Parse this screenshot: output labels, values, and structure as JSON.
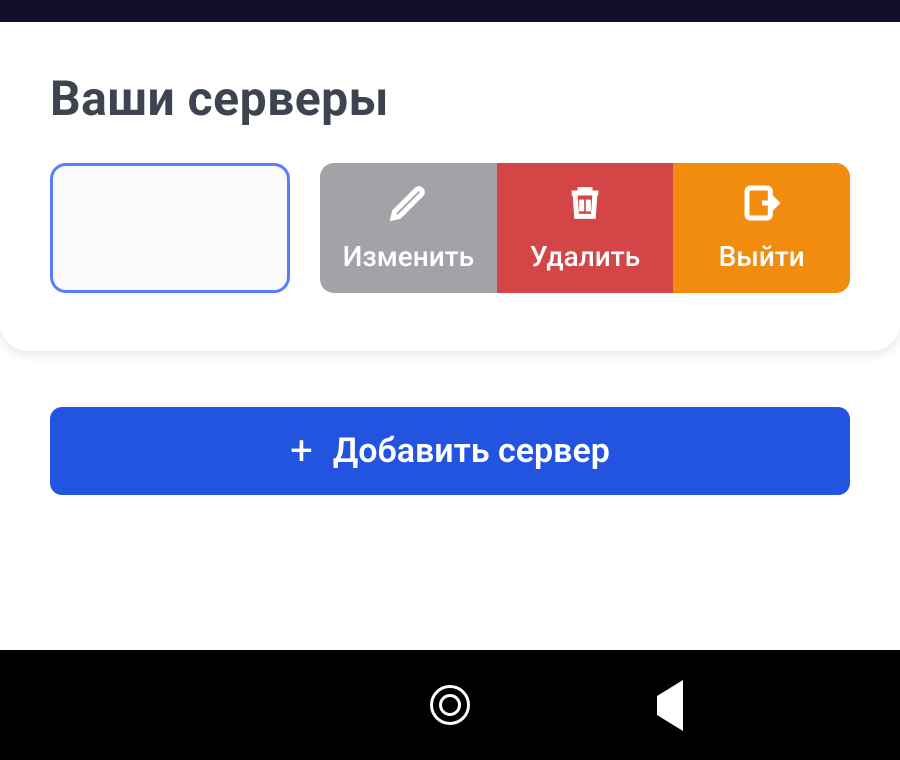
{
  "header": {
    "title": "Ваши серверы"
  },
  "actions": {
    "edit": {
      "label": "Изменить"
    },
    "delete": {
      "label": "Удалить"
    },
    "logout": {
      "label": "Выйти"
    }
  },
  "add_button": {
    "label": "Добавить сервер",
    "plus": "+"
  },
  "colors": {
    "primary": "#2254e0",
    "outline": "#5a7dfc",
    "edit": "#a2a3a7",
    "delete": "#d44547",
    "logout": "#f28c0f"
  }
}
